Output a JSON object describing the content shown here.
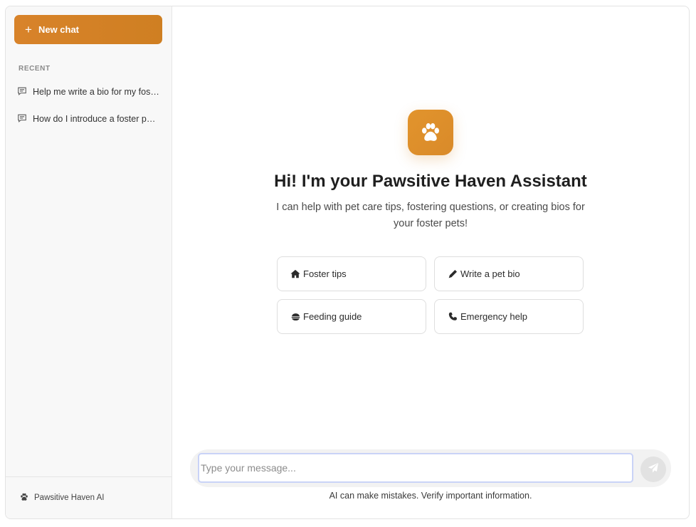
{
  "sidebar": {
    "new_chat_label": "New chat",
    "recent_heading": "RECENT",
    "history": [
      {
        "label": "Help me write a bio for my foster pet"
      },
      {
        "label": "How do I introduce a foster pet to my other pets?"
      }
    ],
    "footer_label": "Pawsitive Haven AI"
  },
  "main": {
    "title": "Hi! I'm your Pawsitive Haven Assistant",
    "subtitle": "I can help with pet care tips, fostering questions, or creating bios for your foster pets!",
    "suggestions": [
      {
        "label": "Foster tips",
        "icon": "home-icon"
      },
      {
        "label": "Write a pet bio",
        "icon": "pencil-icon"
      },
      {
        "label": "Feeding guide",
        "icon": "bowl-icon"
      },
      {
        "label": "Emergency help",
        "icon": "phone-icon"
      }
    ],
    "input_placeholder": "Type your message...",
    "input_value": "",
    "disclaimer": "AI can make mistakes. Verify important information."
  },
  "colors": {
    "accent": "#d8832a",
    "accent_light": "#e2942c",
    "input_focus_border": "#c9d3f7"
  }
}
